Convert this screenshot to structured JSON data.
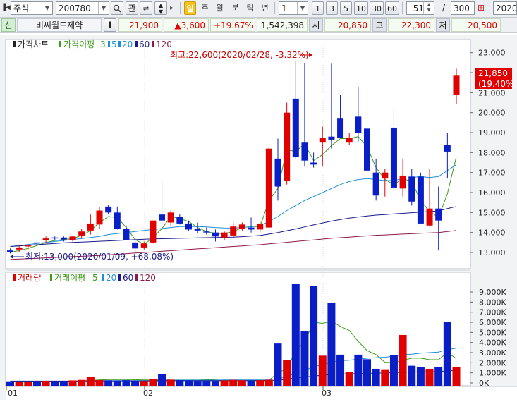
{
  "toolbar": {
    "market": "주식",
    "code": "200780",
    "search_icon": "search-icon",
    "gwan": "관",
    "periods": [
      "일",
      "주",
      "월",
      "분",
      "틱",
      "년"
    ],
    "active_period": "일",
    "count_value": "1",
    "quick_counts": [
      "1",
      "3",
      "5",
      "10",
      "30",
      "60"
    ],
    "page_value": "51",
    "page_sep": "/",
    "page_total": "300",
    "date_value": "2020/"
  },
  "quote": {
    "badge": "신",
    "name": "비씨월드제약",
    "info": "i",
    "price": "21,900",
    "change": "▲3,600",
    "change_pct": "+19.67%",
    "volume": "1,542,398",
    "open_label": "시",
    "open": "20,850",
    "high_label": "고",
    "high": "22,300",
    "low_label": "저",
    "low": "20,500"
  },
  "price_panel": {
    "legend_title": "가격차트",
    "ma_title": "가격이평",
    "ma_periods": [
      "3",
      "5",
      "20",
      "60",
      "120"
    ],
    "ma_colors": [
      "#3c9c1c",
      "#1e8fd8",
      "#1e8fd8",
      "#1a1a8c",
      "#8c1a4a"
    ],
    "high_annotation": "최고:22,600(2020/02/28, -3.32%)",
    "low_annotation": "최저:13,000(2020/01/09, +68.08%)",
    "current_label": "21,850",
    "current_pct": "(19.40%)",
    "y_ticks": [
      "23,000",
      "22,000",
      "21,000",
      "20,000",
      "19,000",
      "18,000",
      "17,000",
      "16,000",
      "15,000",
      "14,000",
      "13,000"
    ]
  },
  "volume_panel": {
    "legend_title": "거래량",
    "ma_title": "거래이평",
    "ma_periods": [
      "5",
      "20",
      "60",
      "120"
    ],
    "y_ticks": [
      "9,000K",
      "8,000K",
      "7,000K",
      "6,000K",
      "5,000K",
      "4,000K",
      "3,000K",
      "2,000K",
      "1,000K",
      "0K"
    ]
  },
  "x_axis": {
    "labels": [
      "01",
      "02",
      "03"
    ]
  },
  "colors": {
    "up": "#e10000",
    "down": "#0a1ec8",
    "ma3": "#3c9c1c",
    "ma20": "#1e8fd8",
    "ma60": "#1a1a8c",
    "ma120": "#8c1a4a"
  },
  "chart_data": {
    "type": "candlestick",
    "price_range": [
      12600,
      23300
    ],
    "volume_range_k": [
      0,
      10000
    ],
    "candles": [
      [
        13100,
        13200,
        12950,
        13000
      ],
      [
        13150,
        13350,
        13000,
        13250
      ],
      [
        13300,
        13400,
        13150,
        13350
      ],
      [
        13500,
        13600,
        13350,
        13450
      ],
      [
        13600,
        13800,
        13450,
        13700
      ],
      [
        13750,
        13800,
        13600,
        13700
      ],
      [
        13750,
        13800,
        13550,
        13650
      ],
      [
        13600,
        13850,
        13550,
        13800
      ],
      [
        13850,
        14200,
        13700,
        14050
      ],
      [
        14100,
        14900,
        13900,
        14450
      ],
      [
        14400,
        15300,
        14200,
        15100
      ],
      [
        15300,
        15400,
        14900,
        15000
      ],
      [
        15000,
        15300,
        14150,
        14200
      ],
      [
        14200,
        14350,
        13600,
        13600
      ],
      [
        13500,
        13700,
        13000,
        13200
      ],
      [
        13250,
        13550,
        13150,
        13450
      ],
      [
        13500,
        14600,
        13450,
        14600
      ],
      [
        14900,
        16650,
        14400,
        14600
      ],
      [
        14500,
        15100,
        14300,
        15000
      ],
      [
        14800,
        14900,
        14400,
        14450
      ],
      [
        14450,
        14600,
        14100,
        14150
      ],
      [
        14200,
        14500,
        13950,
        14100
      ],
      [
        14050,
        14250,
        13900,
        14000
      ],
      [
        14000,
        14150,
        13550,
        13800
      ],
      [
        13750,
        14050,
        13600,
        14000
      ],
      [
        13850,
        14500,
        13700,
        14300
      ],
      [
        14200,
        14500,
        14100,
        14400
      ],
      [
        14250,
        14750,
        14000,
        14150
      ],
      [
        14150,
        14600,
        14000,
        14450
      ],
      [
        14250,
        18300,
        14250,
        18200
      ],
      [
        17700,
        18700,
        15600,
        16300
      ],
      [
        16600,
        20500,
        16400,
        20000
      ],
      [
        20700,
        22600,
        17700,
        17800
      ],
      [
        18500,
        22500,
        17300,
        17600
      ],
      [
        17500,
        18000,
        17250,
        17400
      ],
      [
        18500,
        19300,
        17300,
        18750
      ],
      [
        18800,
        22450,
        18200,
        18650
      ],
      [
        19700,
        20900,
        18750,
        18750
      ],
      [
        18500,
        19000,
        18400,
        18750
      ],
      [
        19800,
        21300,
        18550,
        19000
      ],
      [
        19200,
        19750,
        17100,
        17100
      ],
      [
        17000,
        17700,
        15600,
        15850
      ],
      [
        16700,
        17200,
        15800,
        17000
      ],
      [
        19250,
        20200,
        16050,
        16250
      ],
      [
        16200,
        17700,
        15800,
        16850
      ],
      [
        16800,
        17200,
        15350,
        15550
      ],
      [
        16800,
        17000,
        14450,
        14450
      ],
      [
        14350,
        17200,
        14300,
        15200
      ],
      [
        15200,
        16300,
        13100,
        14600
      ],
      [
        18400,
        19000,
        16700,
        18050
      ],
      [
        20900,
        22200,
        20450,
        21850
      ]
    ],
    "volume_k": [
      160,
      140,
      130,
      160,
      210,
      170,
      170,
      250,
      300,
      630,
      280,
      260,
      240,
      270,
      220,
      190,
      380,
      850,
      320,
      280,
      260,
      200,
      200,
      200,
      250,
      300,
      260,
      250,
      270,
      310,
      3900,
      2250,
      9800,
      5100,
      9600,
      2700,
      7900,
      2800,
      1100,
      2800,
      2350,
      1400,
      1350,
      2750,
      4750,
      1700,
      1550,
      1400,
      1600,
      6050,
      1550
    ],
    "series": [
      {
        "name": "3",
        "values": [
          13000,
          13100,
          13200,
          13350,
          13500,
          13600,
          13650,
          13700,
          13850,
          14100,
          14500,
          14800,
          14750,
          14250,
          13650,
          13400,
          13750,
          14200,
          14800,
          14700,
          14550,
          14250,
          14050,
          13950,
          13950,
          14050,
          14250,
          14300,
          14300,
          15600,
          16200,
          18150,
          18050,
          18450,
          17600,
          17900,
          18350,
          18700,
          18700,
          18800,
          18300,
          17250,
          16650,
          16400,
          16700,
          16550,
          15600,
          15050,
          14750,
          15950,
          17800
        ]
      },
      {
        "name": "20",
        "values": [
          13300,
          13350,
          13400,
          13450,
          13500,
          13550,
          13600,
          13650,
          13700,
          13750,
          13800,
          13900,
          13950,
          14000,
          14050,
          14100,
          14150,
          14200,
          14250,
          14300,
          14300,
          14300,
          14280,
          14250,
          14230,
          14220,
          14250,
          14300,
          14350,
          14550,
          14800,
          15100,
          15350,
          15600,
          15800,
          16000,
          16200,
          16400,
          16550,
          16650,
          16700,
          16650,
          16600,
          16600,
          16700,
          16750,
          16800,
          16750,
          16800,
          17100,
          17400
        ]
      },
      {
        "name": "60",
        "values": [
          13300,
          13330,
          13360,
          13390,
          13420,
          13450,
          13480,
          13500,
          13520,
          13540,
          13560,
          13580,
          13600,
          13620,
          13640,
          13660,
          13680,
          13690,
          13700,
          13710,
          13720,
          13730,
          13740,
          13750,
          13760,
          13770,
          13790,
          13820,
          13850,
          13920,
          14000,
          14090,
          14180,
          14280,
          14380,
          14480,
          14570,
          14650,
          14720,
          14780,
          14830,
          14870,
          14900,
          14930,
          14960,
          14990,
          15020,
          15050,
          15080,
          15200,
          15300
        ]
      },
      {
        "name": "120",
        "values": [
          12650,
          12670,
          12690,
          12710,
          12730,
          12750,
          12770,
          12790,
          12810,
          12830,
          12850,
          12880,
          12910,
          12940,
          12970,
          13000,
          13030,
          13060,
          13090,
          13120,
          13150,
          13180,
          13210,
          13240,
          13270,
          13300,
          13330,
          13360,
          13390,
          13430,
          13470,
          13510,
          13550,
          13590,
          13630,
          13670,
          13710,
          13740,
          13770,
          13800,
          13830,
          13860,
          13880,
          13900,
          13920,
          13940,
          13960,
          13980,
          14000,
          14050,
          14100
        ]
      }
    ],
    "volume_ma": [
      {
        "name": "5",
        "values": [
          150,
          150,
          150,
          155,
          160,
          165,
          170,
          180,
          200,
          250,
          300,
          330,
          340,
          330,
          320,
          300,
          280,
          350,
          380,
          380,
          380,
          380,
          350,
          300,
          250,
          230,
          230,
          240,
          250,
          270,
          1000,
          1400,
          3200,
          4100,
          6000,
          5900,
          6100,
          5600,
          5200,
          4100,
          3200,
          2800,
          2050,
          2000,
          2250,
          2450,
          2450,
          2300,
          2300,
          3000,
          2400
        ]
      },
      {
        "name": "20",
        "values": [
          160,
          160,
          160,
          160,
          165,
          165,
          170,
          170,
          175,
          200,
          210,
          215,
          220,
          225,
          230,
          230,
          235,
          260,
          270,
          280,
          280,
          280,
          280,
          280,
          290,
          290,
          300,
          300,
          300,
          310,
          480,
          600,
          1000,
          1200,
          1650,
          1750,
          2100,
          2200,
          2250,
          2350,
          2450,
          2500,
          2550,
          2650,
          2800,
          2850,
          2950,
          3000,
          3050,
          3300,
          3450
        ]
      },
      {
        "name": "60",
        "values": [
          180,
          180,
          180,
          180,
          180,
          180,
          180,
          180,
          185,
          190,
          195,
          195,
          200,
          200,
          200,
          200,
          205,
          210,
          210,
          215,
          215,
          215,
          215,
          215,
          215,
          220,
          220,
          220,
          225,
          230,
          300,
          340,
          500,
          560,
          700,
          740,
          860,
          890,
          900,
          930,
          950,
          970,
          990,
          1010,
          1060,
          1080,
          1100,
          1110,
          1120,
          1200,
          1230
        ]
      }
    ]
  }
}
